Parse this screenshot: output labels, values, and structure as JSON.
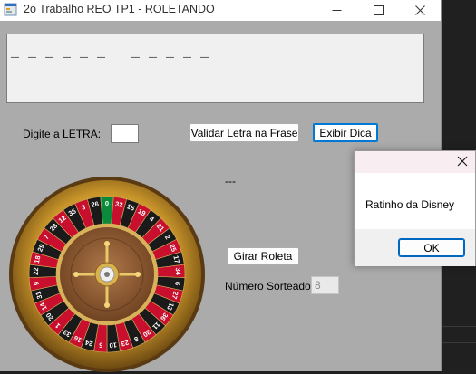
{
  "window": {
    "title": "2o Trabalho REO TP1 - ROLETANDO"
  },
  "phrase": {
    "display": "_ _ _ _ _ _   _ _ _ _ _"
  },
  "letter_input": {
    "label": "Digite a LETRA:",
    "value": ""
  },
  "buttons": {
    "validate_label": "Validar Letra na Frase",
    "hint_label": "Exibir Dica",
    "spin_label": "Girar Roleta"
  },
  "result_text": "---",
  "drawn_number": {
    "label": "Número Sorteado:",
    "value": "8"
  },
  "roulette": {
    "numbers": [
      "0",
      "32",
      "15",
      "19",
      "4",
      "21",
      "2",
      "25",
      "17",
      "34",
      "6",
      "27",
      "13",
      "36",
      "11",
      "30",
      "8",
      "23",
      "10",
      "5",
      "24",
      "16",
      "33",
      "1",
      "20",
      "14",
      "31",
      "9",
      "22",
      "18",
      "29",
      "7",
      "28",
      "12",
      "35",
      "3",
      "26"
    ]
  },
  "dialog": {
    "message": "Ratinho da Disney",
    "ok_label": "OK"
  },
  "colors": {
    "red": "#c8102e",
    "black": "#1a1a1a",
    "green": "#0a8a3a",
    "gold": "#c79a2e"
  }
}
